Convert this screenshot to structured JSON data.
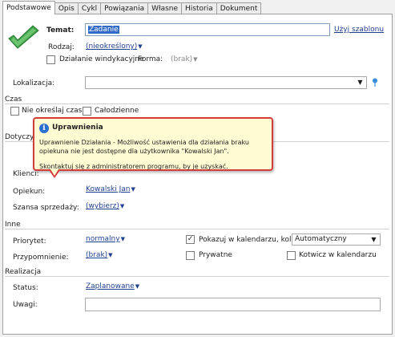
{
  "tabs": [
    "Podstawowe",
    "Opis",
    "Cykl",
    "Powiązania",
    "Własne",
    "Historia",
    "Dokument"
  ],
  "header": {
    "temat_label": "Temat:",
    "temat_value": "Zadanie",
    "uzyj_szablonu": "Użyj szablonu",
    "rodzaj_label": "Rodzaj:",
    "rodzaj_value": "(nieokreślony)",
    "windykacyjne_label": "Działanie windykacyjne",
    "forma_label": "Forma:",
    "forma_value": "(brak)"
  },
  "lokalizacja": {
    "label": "Lokalizacja:",
    "value": ""
  },
  "czas": {
    "section": "Czas",
    "nie_okreslaj": "Nie określaj czasu",
    "calodzienne": "Całodzienne"
  },
  "dotyczy": {
    "section": "Dotyczy",
    "klienci_label": "Klienci:",
    "opiekun_label": "Opiekun:",
    "opiekun_value": "Kowalski Jan",
    "szansa_label": "Szansa sprzedaży:",
    "szansa_value": "(wybierz)"
  },
  "inne": {
    "section": "Inne",
    "priorytet_label": "Priorytet:",
    "priorytet_value": "normalny",
    "pokazuj_label": "Pokazuj w kalendarzu, kolor:",
    "kolor_value": "Automatyczny",
    "przypomnienie_label": "Przypomnienie:",
    "przypomnienie_value": "(brak)",
    "prywatne_label": "Prywatne",
    "kotwicz_label": "Kotwicz w kalendarzu"
  },
  "realizacja": {
    "section": "Realizacja",
    "status_label": "Status:",
    "status_value": "Zaplanowane",
    "uwagi_label": "Uwagi:",
    "uwagi_value": ""
  },
  "tooltip": {
    "title": "Uprawnienia",
    "line1": "Uprawnienie Działania - Możliwość ustawienia dla działania braku opiekuna nie jest dostępne dla użytkownika \"Kowalski Jan\".",
    "line2": "Skontaktuj się z administratorem programu, by je uzyskać."
  },
  "icons": {
    "task_icon": "green-check-arrow-icon",
    "location_icon": "map-pin-icon",
    "info_icon": "info-icon"
  },
  "colors": {
    "link": "#1f3f8f",
    "tooltip_bg": "#fffbd2",
    "tooltip_border": "#d43c3c",
    "selection": "#3169c6"
  }
}
